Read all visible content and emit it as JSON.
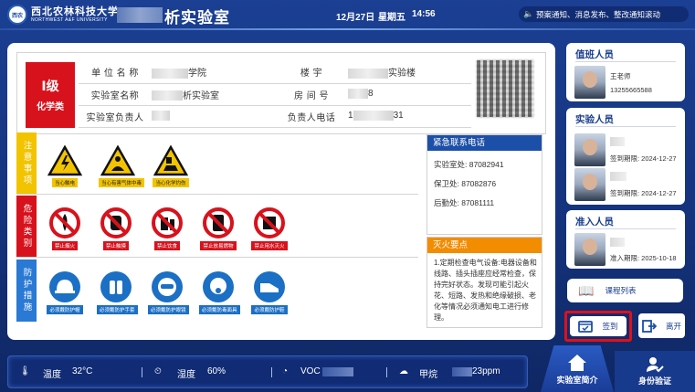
{
  "header": {
    "logo_cn": "西北农林科技大学",
    "logo_en": "NORTHWEST A&F UNIVERSITY",
    "logo_mark": "西农",
    "title": "析实验室",
    "date": "12月27日",
    "weekday": "星期五",
    "time": "14:56",
    "ticker": "预案通知、消息发布、整改通知滚动"
  },
  "info": {
    "level": "Ⅰ级",
    "level_type": "化学类",
    "unit_label": "单 位 名 称",
    "unit_value": "学院",
    "building_label": "楼       宇",
    "building_value": "实验楼",
    "lab_label": "实验室名称",
    "lab_value": "析实验室",
    "room_label": "房    间    号",
    "room_value": "8",
    "manager_label": "实验室负责人",
    "phone_label": "负责人电话",
    "phone_value_start": "1",
    "phone_value_end": "31"
  },
  "safety": {
    "caution_title": "注意事项",
    "danger_title": "危险类别",
    "protect_title": "防护措施",
    "caution": [
      "当心触电",
      "当心有害气体中毒",
      "当心化学灼伤"
    ],
    "danger": [
      "禁止烟火",
      "禁止触摸",
      "禁止饮食",
      "禁止放易燃物",
      "禁止用水灭火"
    ],
    "protect": [
      "必须戴防护帽",
      "必须戴防护手套",
      "必须戴防护眼镜",
      "必须戴防毒面具",
      "必须戴防护鞋"
    ]
  },
  "contact": {
    "title": "紧急联系电话",
    "lines": [
      "实验室处:  87082941",
      "保卫处:  87082876",
      "后勤处:  87081111"
    ]
  },
  "fire": {
    "title": "灭火要点",
    "text": "1.定期检查电气设备:电器设备和线路、插头插座应经常检查，保持完好状态。发现可能引起火花、短路、发热和绝缘破损、老化等情况必须通知电工进行修理。"
  },
  "duty": {
    "title": "值班人员",
    "name": "王老师",
    "phone": "13255665588"
  },
  "lab_staff": {
    "title": "实验人员",
    "items": [
      {
        "expiry": "签到期限:  2024-12-27"
      },
      {
        "expiry": "签到期限:  2024-12-27"
      }
    ]
  },
  "admitted": {
    "title": "准入人员",
    "expiry": "准入期限:  2025-10-18"
  },
  "buttons": {
    "course": "课程列表",
    "sign": "签到",
    "leave": "离开"
  },
  "footer": {
    "temp_label": "温度",
    "temp_value": "32°C",
    "humidity_label": "湿度",
    "humidity_value": "60%",
    "voc_label": "VOC",
    "methane_label": "甲烷",
    "methane_value": "23ppm"
  },
  "nav": {
    "intro": "实验室简介",
    "identity": "身份验证"
  }
}
